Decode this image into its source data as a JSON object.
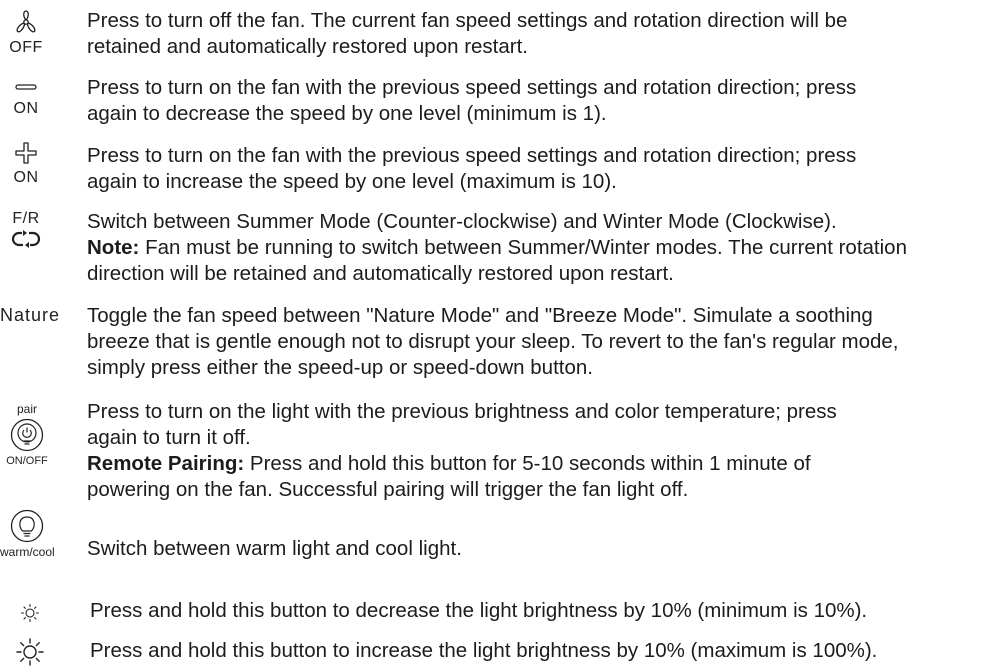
{
  "rows": [
    {
      "icon": {
        "name": "fan-icon",
        "label": "OFF"
      },
      "lines": [
        "Press to turn off the fan. The current fan speed settings and rotation direction will be",
        "retained and automatically restored upon restart."
      ]
    },
    {
      "icon": {
        "name": "minus-icon",
        "label": "ON"
      },
      "lines": [
        "Press to turn on the fan with the previous speed settings and rotation direction; press",
        "again to decrease the speed by one level (minimum is 1)."
      ]
    },
    {
      "icon": {
        "name": "plus-icon",
        "label": "ON"
      },
      "lines": [
        "Press to turn on the fan with the previous speed settings and rotation direction; press",
        "again to increase the speed by one level (maximum is 10)."
      ]
    },
    {
      "icon": {
        "name": "reverse-icon",
        "label": "F/R"
      },
      "lines": [
        "Switch between Summer Mode (Counter-clockwise) and Winter Mode (Clockwise)."
      ],
      "note_label": "Note:",
      "note_lines": [
        " Fan must be running to switch between Summer/Winter modes. The current rotation",
        "direction will be retained and automatically restored upon restart."
      ]
    },
    {
      "icon": {
        "name": "nature-label",
        "label": "Nature"
      },
      "lines": [
        "Toggle the fan speed between \"Nature Mode\" and \"Breeze Mode\". Simulate a soothing",
        "breeze that is gentle enough not to disrupt your sleep. To revert to the fan's regular mode,",
        "simply press either the speed-up or speed-down button."
      ]
    },
    {
      "icon": {
        "name": "power-bulb-icon",
        "top_label": "pair",
        "label": "ON/OFF"
      },
      "lines": [
        "Press to turn on the light with the previous brightness and color temperature; press",
        "again to turn it off."
      ],
      "note_label": "Remote Pairing:",
      "note_lines": [
        " Press and hold this button for 5-10 seconds within 1 minute of",
        "powering on the fan. Successful pairing will trigger the fan light off."
      ]
    },
    {
      "icon": {
        "name": "bulb-icon",
        "label": "warm/cool"
      },
      "lines": [
        "Switch between warm light and cool light."
      ]
    },
    {
      "icon": {
        "name": "sun-small-icon"
      },
      "lines": [
        "Press and hold this button to decrease the light brightness by 10% (minimum is 10%)."
      ]
    },
    {
      "icon": {
        "name": "sun-large-icon"
      },
      "lines": [
        "Press and hold this button to increase the light brightness by 10% (maximum is 100%)."
      ]
    }
  ]
}
